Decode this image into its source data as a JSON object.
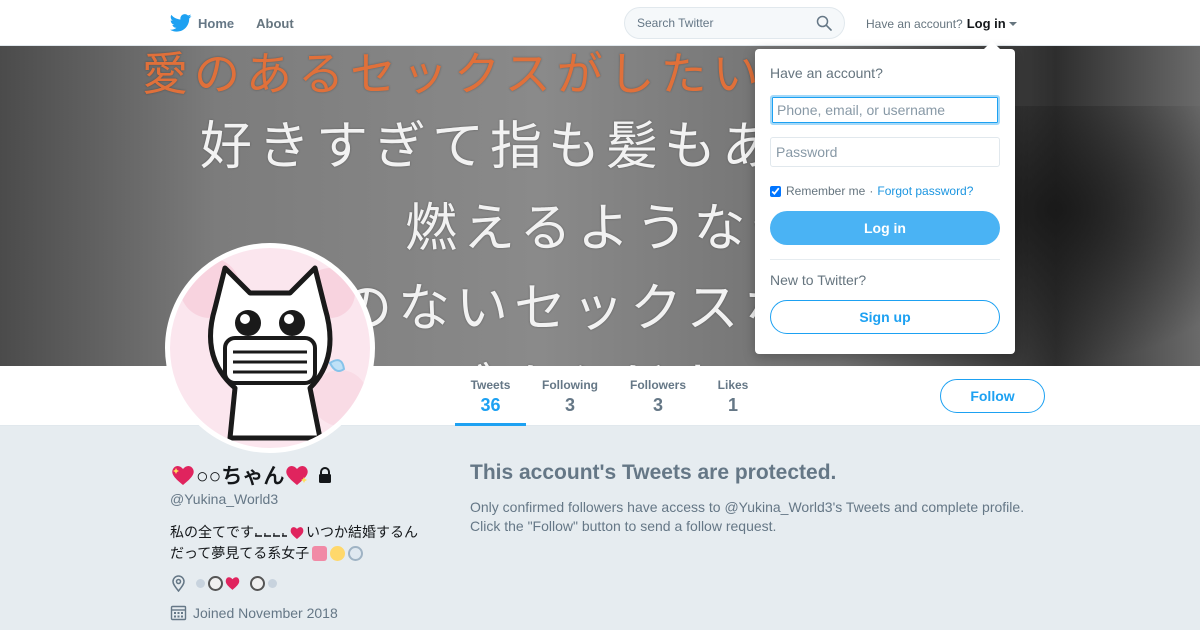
{
  "colors": {
    "brand": "#1da1f2",
    "muted": "#657786",
    "page_bg": "#e6ecf0",
    "heart_red": "#e0245e",
    "banner_orange": "#e0703a"
  },
  "topnav": {
    "logo_icon": "twitter-bird-icon",
    "home_label": "Home",
    "about_label": "About",
    "search_placeholder": "Search Twitter",
    "search_icon": "search-icon",
    "have_account_label": "Have an account?",
    "login_label": "Log in"
  },
  "banner": {
    "lines": [
      "愛のあるセックスがしたい",
      "好きすぎて指も髪もあ",
      "燃えるようなセ",
      "のないセックスな",
      "ごめんだよ"
    ]
  },
  "profile_nav": {
    "stats": [
      {
        "label": "Tweets",
        "value": "36"
      },
      {
        "label": "Following",
        "value": "3"
      },
      {
        "label": "Followers",
        "value": "3"
      },
      {
        "label": "Likes",
        "value": "1"
      }
    ],
    "follow_label": "Follow"
  },
  "profile": {
    "name": "○○ちゃん",
    "handle": "@Yukina_World3",
    "bio_line1_a": "私の全てです",
    "bio_line1_b": "いつか結婚するん",
    "bio_line2": "だって夢見てる系女子",
    "location_icon": "location-pin-icon",
    "calendar_icon": "calendar-icon",
    "joined": "Joined November 2018"
  },
  "protected": {
    "title": "This account's Tweets are protected.",
    "body": "Only confirmed followers have access to @Yukina_World3's Tweets and complete profile. Click the \"Follow\" button to send a follow request."
  },
  "login_dropdown": {
    "heading": "Have an account?",
    "username_placeholder": "Phone, email, or username",
    "password_placeholder": "Password",
    "remember_label": "Remember me",
    "separator": "·",
    "forgot_label": "Forgot password?",
    "login_button": "Log in",
    "new_heading": "New to Twitter?",
    "signup_button": "Sign up"
  }
}
